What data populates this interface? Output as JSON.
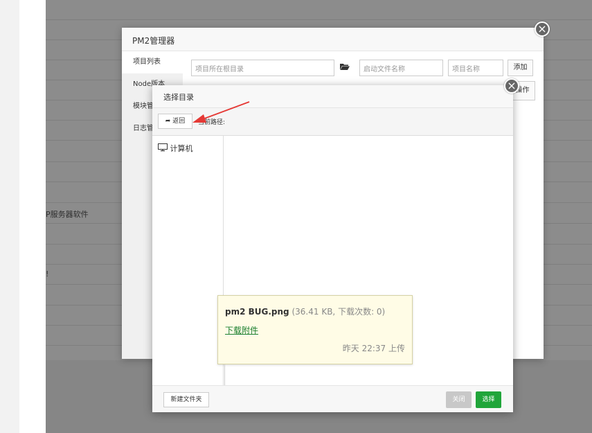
{
  "background": {
    "labels": [
      "P服务器软件",
      "!"
    ]
  },
  "pm2": {
    "title": "PM2管理器",
    "sidebar": [
      "项目列表",
      "Node版本",
      "模块管",
      "日志管"
    ],
    "inputs": {
      "dir_placeholder": "项目所在根目录",
      "start_placeholder": "启动文件名称",
      "name_placeholder": "项目名称"
    },
    "add_label": "添加",
    "action_label": "操作"
  },
  "dir_dialog": {
    "title": "选择目录",
    "back_label": "返回",
    "path_label": "当前路径:",
    "tree_item": "计算机",
    "new_folder_label": "新建文件夹",
    "close_label": "关闭",
    "select_label": "选择"
  },
  "tooltip": {
    "filename": "pm2 BUG.png",
    "meta": "(36.41 KB, 下载次数: 0)",
    "link": "下载附件",
    "time": "昨天 22:37 上传"
  },
  "colors": {
    "accent_green": "#20a53a",
    "disabled_gray": "#c8c8c8",
    "tooltip_bg": "#fffce6",
    "arrow_red": "#e53935"
  }
}
